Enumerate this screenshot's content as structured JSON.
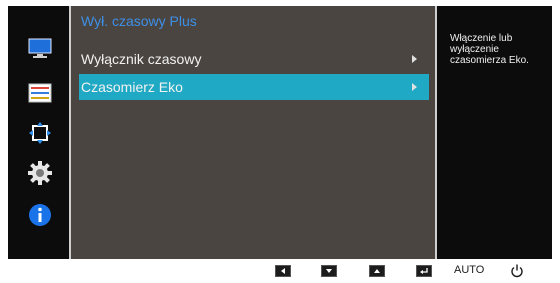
{
  "menu": {
    "title": "Wył. czasowy Plus",
    "items": [
      {
        "label": "Wyłącznik czasowy",
        "has_submenu": true,
        "selected": false
      },
      {
        "label": "Czasomierz Eko",
        "has_submenu": true,
        "selected": true
      }
    ]
  },
  "help_text": "Włączenie lub wyłączenie czasomierza Eko.",
  "sidebar": {
    "icons": [
      "monitor-icon",
      "picture-settings-icon",
      "position-size-icon",
      "settings-gear-icon",
      "info-icon"
    ]
  },
  "bottom_bar": {
    "buttons": [
      "left-arrow",
      "down-arrow",
      "up-arrow",
      "enter"
    ],
    "auto_label": "AUTO",
    "power": "power-icon"
  },
  "colors": {
    "osd_background": "#0c0c0c",
    "panel_background": "#4a4540",
    "selected_item": "#1fa9c4",
    "title_text": "#3d8fe8",
    "monitor_icon": "#1e6fd9",
    "info_icon": "#1a73e8"
  }
}
